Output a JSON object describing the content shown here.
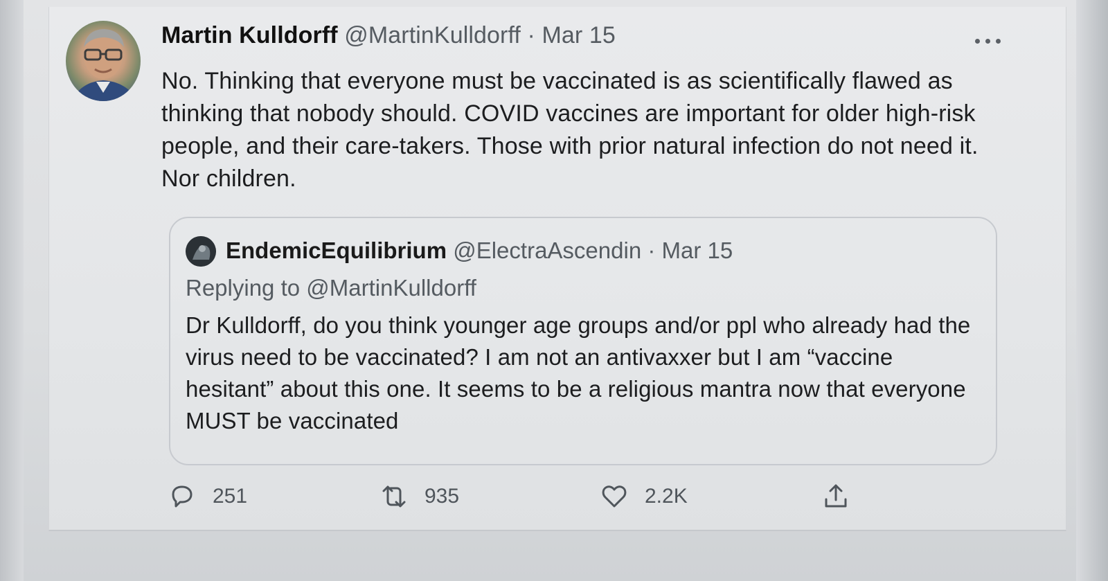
{
  "tweet": {
    "author_name": "Martin Kulldorff",
    "author_handle": "@MartinKulldorff",
    "separator": "·",
    "date": "Mar 15",
    "text": "No. Thinking that everyone must be vaccinated is as scientifically flawed as thinking that nobody should. COVID vaccines are important for older high-risk people, and their care-takers. Those with prior natural infection do not need it. Nor children.",
    "more_icon": "more-horizontal-icon"
  },
  "quoted_tweet": {
    "author_name": "EndemicEquilibrium",
    "author_handle": "@ElectraAscendin",
    "separator": "·",
    "date": "Mar 15",
    "replying_prefix": "Replying to",
    "replying_to": "@MartinKulldorff",
    "text": "Dr Kulldorff, do you think younger age groups and/or ppl who already had the virus need to be vaccinated? I am not an antivaxxer but I am “vaccine hesitant” about this one. It seems to be a religious mantra now that everyone MUST be vaccinated"
  },
  "actions": {
    "reply_count": "251",
    "retweet_count": "935",
    "like_count": "2.2K",
    "icons": [
      "reply-icon",
      "retweet-icon",
      "heart-icon",
      "share-icon"
    ]
  }
}
